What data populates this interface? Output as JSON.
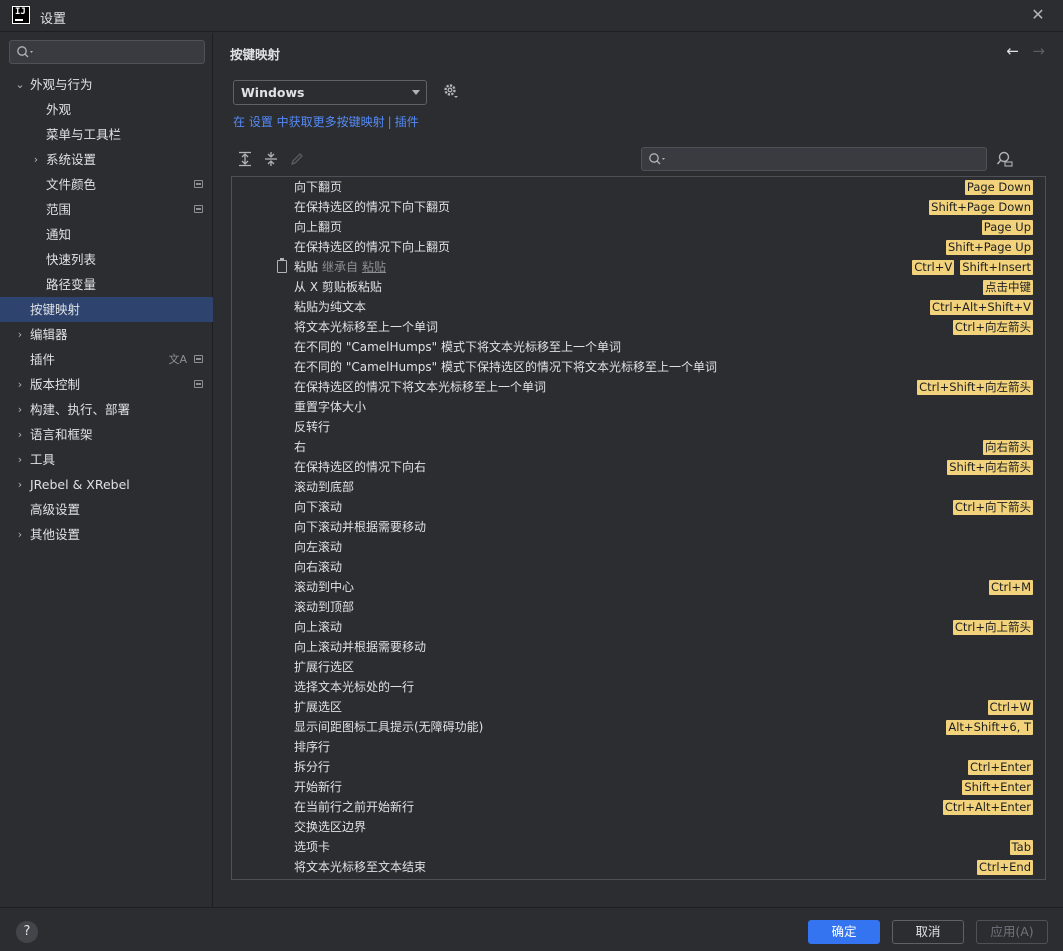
{
  "window": {
    "title": "设置",
    "close_glyph": "✕"
  },
  "sidebar": {
    "search_placeholder": "",
    "items": [
      {
        "label": "外观与行为",
        "chevron": "⌄",
        "bold": true
      },
      {
        "label": "外观"
      },
      {
        "label": "菜单与工具栏"
      },
      {
        "label": "系统设置",
        "chevron": "›"
      },
      {
        "label": "文件颜色",
        "badge": true
      },
      {
        "label": "范围",
        "badge": true
      },
      {
        "label": "通知"
      },
      {
        "label": "快速列表"
      },
      {
        "label": "路径变量"
      },
      {
        "label": "按键映射",
        "selected": true
      },
      {
        "label": "编辑器",
        "chevron": "›"
      },
      {
        "label": "插件",
        "badge": true,
        "lang": "文A"
      },
      {
        "label": "版本控制",
        "chevron": "›",
        "badge": true
      },
      {
        "label": "构建、执行、部署",
        "chevron": "›"
      },
      {
        "label": "语言和框架",
        "chevron": "›"
      },
      {
        "label": "工具",
        "chevron": "›"
      },
      {
        "label": "JRebel & XRebel",
        "chevron": "›"
      },
      {
        "label": "高级设置"
      },
      {
        "label": "其他设置",
        "chevron": "›"
      }
    ]
  },
  "main": {
    "title": "按键映射",
    "nav_back": "←",
    "nav_forward": "→",
    "keymap": "Windows",
    "link_text": "在 设置 中获取更多按键映射",
    "link_sep": "|",
    "link_plugins": "插件",
    "filter_placeholder": ""
  },
  "actions": [
    {
      "name": "向下翻页",
      "keys": [
        "Page Down"
      ]
    },
    {
      "name": "在保持选区的情况下向下翻页",
      "keys": [
        "Shift+Page Down"
      ]
    },
    {
      "name": "向上翻页",
      "keys": [
        "Page Up"
      ]
    },
    {
      "name": "在保持选区的情况下向上翻页",
      "keys": [
        "Shift+Page Up"
      ]
    },
    {
      "name": "粘贴",
      "inherit_prefix": "继承自",
      "inherit_link": "粘贴",
      "keys": [
        "Ctrl+V",
        "Shift+Insert"
      ],
      "icon": "clipboard-icon"
    },
    {
      "name": "从 X 剪贴板粘贴",
      "keys": [
        "点击中键"
      ]
    },
    {
      "name": "粘贴为纯文本",
      "keys": [
        "Ctrl+Alt+Shift+V"
      ]
    },
    {
      "name": "将文本光标移至上一个单词",
      "keys": [
        "Ctrl+向左箭头"
      ]
    },
    {
      "name": "在不同的 \"CamelHumps\" 模式下将文本光标移至上一个单词",
      "keys": []
    },
    {
      "name": "在不同的 \"CamelHumps\" 模式下保持选区的情况下将文本光标移至上一个单词",
      "keys": []
    },
    {
      "name": "在保持选区的情况下将文本光标移至上一个单词",
      "keys": [
        "Ctrl+Shift+向左箭头"
      ]
    },
    {
      "name": "重置字体大小",
      "keys": []
    },
    {
      "name": "反转行",
      "keys": []
    },
    {
      "name": "右",
      "keys": [
        "向右箭头"
      ]
    },
    {
      "name": "在保持选区的情况下向右",
      "keys": [
        "Shift+向右箭头"
      ]
    },
    {
      "name": "滚动到底部",
      "keys": []
    },
    {
      "name": "向下滚动",
      "keys": [
        "Ctrl+向下箭头"
      ]
    },
    {
      "name": "向下滚动并根据需要移动",
      "keys": []
    },
    {
      "name": "向左滚动",
      "keys": []
    },
    {
      "name": "向右滚动",
      "keys": []
    },
    {
      "name": "滚动到中心",
      "keys": [
        "Ctrl+M"
      ]
    },
    {
      "name": "滚动到顶部",
      "keys": []
    },
    {
      "name": "向上滚动",
      "keys": [
        "Ctrl+向上箭头"
      ]
    },
    {
      "name": "向上滚动并根据需要移动",
      "keys": []
    },
    {
      "name": "扩展行选区",
      "keys": []
    },
    {
      "name": "选择文本光标处的一行",
      "keys": []
    },
    {
      "name": "扩展选区",
      "keys": [
        "Ctrl+W"
      ]
    },
    {
      "name": "显示间距图标工具提示(无障碍功能)",
      "keys": [
        "Alt+Shift+6, T"
      ]
    },
    {
      "name": "排序行",
      "keys": []
    },
    {
      "name": "拆分行",
      "keys": [
        "Ctrl+Enter"
      ]
    },
    {
      "name": "开始新行",
      "keys": [
        "Shift+Enter"
      ]
    },
    {
      "name": "在当前行之前开始新行",
      "keys": [
        "Ctrl+Alt+Enter"
      ]
    },
    {
      "name": "交换选区边界",
      "keys": []
    },
    {
      "name": "选项卡",
      "keys": [
        "Tab"
      ]
    },
    {
      "name": "将文本光标移至文本结束",
      "keys": [
        "Ctrl+End"
      ]
    }
  ],
  "footer": {
    "help": "?",
    "ok": "确定",
    "cancel": "取消",
    "apply": "应用(A)"
  }
}
